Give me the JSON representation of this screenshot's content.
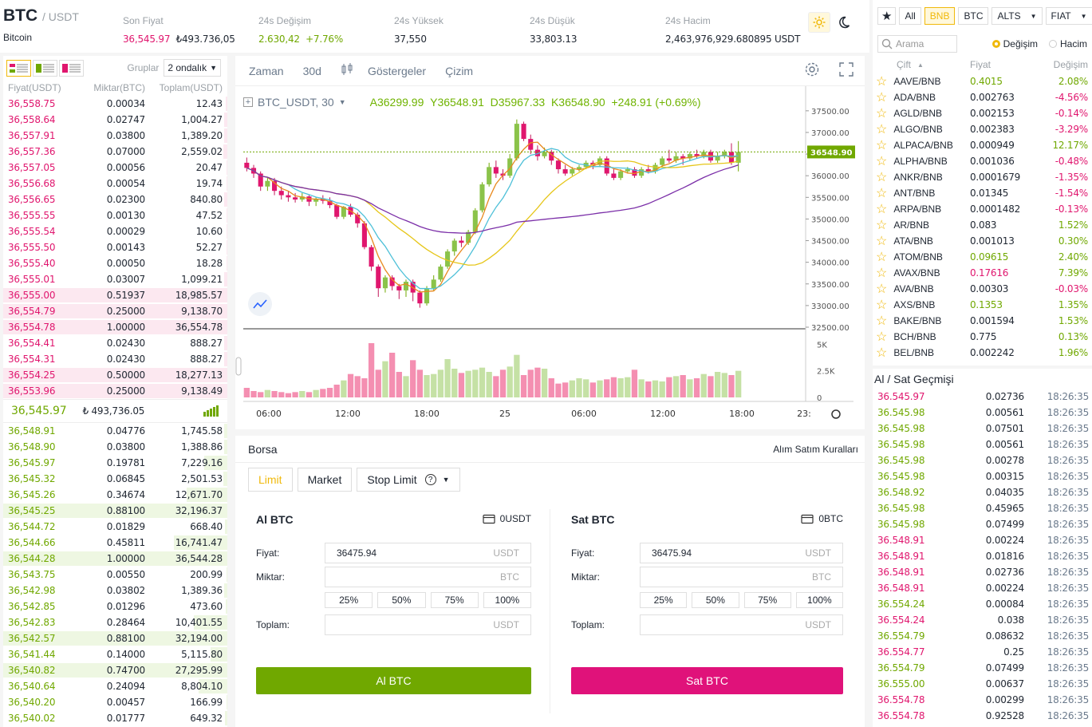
{
  "header": {
    "base": "BTC",
    "quote": "/ USDT",
    "name": "Bitcoin",
    "last_label": "Son Fiyat",
    "last_price": "36,545.97",
    "last_try": "₺493.736,05",
    "change_label": "24s Değişim",
    "change_abs": "2.630,42",
    "change_pct": "+7.76%",
    "high_label": "24s Yüksek",
    "high": "37,550",
    "low_label": "24s Düşük",
    "low": "33,803.13",
    "vol_label": "24s Hacim",
    "vol": "2,463,976,929.680895 USDT"
  },
  "orderbook": {
    "groups_label": "Gruplar",
    "decimals": "2 ondalık",
    "col_price": "Fiyat(USDT)",
    "col_amount": "Miktar(BTC)",
    "col_total": "Toplam(USDT)",
    "asks": [
      [
        "36,558.75",
        "0.00034",
        "12.43",
        2
      ],
      [
        "36,558.64",
        "0.02747",
        "1,004.27",
        4
      ],
      [
        "36,557.91",
        "0.03800",
        "1,389.20",
        4
      ],
      [
        "36,557.36",
        "0.07000",
        "2,559.02",
        6
      ],
      [
        "36,557.05",
        "0.00056",
        "20.47",
        1
      ],
      [
        "36,556.68",
        "0.00054",
        "19.74",
        1
      ],
      [
        "36,556.65",
        "0.02300",
        "840.80",
        4
      ],
      [
        "36,555.55",
        "0.00130",
        "47.52",
        1
      ],
      [
        "36,555.54",
        "0.00029",
        "10.60",
        1
      ],
      [
        "36,555.50",
        "0.00143",
        "52.27",
        1
      ],
      [
        "36,555.40",
        "0.00050",
        "18.28",
        1
      ],
      [
        "36,555.01",
        "0.03007",
        "1,099.21",
        5
      ],
      [
        "36,555.00",
        "0.51937",
        "18,985.57",
        100
      ],
      [
        "36,554.79",
        "0.25000",
        "9,138.70",
        100
      ],
      [
        "36,554.78",
        "1.00000",
        "36,554.78",
        100
      ],
      [
        "36,554.41",
        "0.02430",
        "888.27",
        4
      ],
      [
        "36,554.31",
        "0.02430",
        "888.27",
        4
      ],
      [
        "36,554.25",
        "0.50000",
        "18,277.13",
        100
      ],
      [
        "36,553.96",
        "0.25000",
        "9,138.49",
        100
      ]
    ],
    "mid_price": "36,545.97",
    "mid_try": "₺ 493,736.05",
    "bids": [
      [
        "36,548.91",
        "0.04776",
        "1,745.58",
        4
      ],
      [
        "36,548.90",
        "0.03800",
        "1,388.86",
        4
      ],
      [
        "36,545.97",
        "0.19781",
        "7,229.16",
        32
      ],
      [
        "36,545.32",
        "0.06845",
        "2,501.53",
        6
      ],
      [
        "36,545.26",
        "0.34674",
        "12,671.70",
        57
      ],
      [
        "36,545.25",
        "0.88100",
        "32,196.37",
        100
      ],
      [
        "36,544.72",
        "0.01829",
        "668.40",
        3
      ],
      [
        "36,544.66",
        "0.45811",
        "16,741.47",
        75
      ],
      [
        "36,544.28",
        "1.00000",
        "36,544.28",
        100
      ],
      [
        "36,543.75",
        "0.00550",
        "200.99",
        1
      ],
      [
        "36,542.98",
        "0.03802",
        "1,389.36",
        4
      ],
      [
        "36,542.85",
        "0.01296",
        "473.60",
        2
      ],
      [
        "36,542.83",
        "0.28464",
        "10,401.55",
        47
      ],
      [
        "36,542.57",
        "0.88100",
        "32,194.00",
        100
      ],
      [
        "36,541.44",
        "0.14000",
        "5,115.80",
        23
      ],
      [
        "36,540.82",
        "0.74700",
        "27,295.99",
        100
      ],
      [
        "36,540.64",
        "0.24094",
        "8,804.10",
        40
      ],
      [
        "36,540.20",
        "0.00457",
        "166.99",
        1
      ],
      [
        "36,540.02",
        "0.01777",
        "649.32",
        3
      ]
    ]
  },
  "chart": {
    "tools": [
      "Zaman",
      "30d",
      "Göstergeler",
      "Çizim"
    ],
    "title": "BTC_USDT, 30",
    "ohlc": {
      "a": "A36299.99",
      "y": "Y36548.91",
      "d": "D35967.33",
      "k": "K36548.90",
      "chg": "+248.91 (+0.69%)"
    },
    "price_axis": [
      "37500.00",
      "37000.00",
      "36500.00",
      "36000.00",
      "35500.00",
      "35000.00",
      "34500.00",
      "34000.00",
      "33500.00",
      "33000.00",
      "32500.00"
    ],
    "vol_axis": [
      "5K",
      "2.5K",
      "0"
    ],
    "time_axis": [
      "06:00",
      "12:00",
      "18:00",
      "25",
      "06:00",
      "12:00",
      "18:00",
      "23:"
    ],
    "last_tag": "36548.90"
  },
  "chart_data": {
    "type": "candlestick",
    "ylim": [
      32500,
      37700
    ],
    "candles": [
      [
        36300,
        36180,
        36420,
        36100
      ],
      [
        36180,
        36050,
        36250,
        35950
      ],
      [
        36050,
        35750,
        36100,
        35650
      ],
      [
        35750,
        35880,
        35950,
        35650
      ],
      [
        35880,
        35650,
        35950,
        35550
      ],
      [
        35650,
        35550,
        35750,
        35450
      ],
      [
        35550,
        35500,
        35650,
        35400
      ],
      [
        35500,
        35450,
        35600,
        35380
      ],
      [
        35450,
        35520,
        35600,
        35400
      ],
      [
        35520,
        35400,
        35550,
        35300
      ],
      [
        35400,
        35470,
        35500,
        35300
      ],
      [
        35470,
        35420,
        35550,
        35350
      ],
      [
        35420,
        35320,
        35500,
        35250
      ],
      [
        35320,
        35050,
        35350,
        35000
      ],
      [
        35050,
        35280,
        35300,
        35000
      ],
      [
        35280,
        35100,
        35350,
        35050
      ],
      [
        35100,
        34900,
        35150,
        34800
      ],
      [
        34900,
        34350,
        34950,
        34300
      ],
      [
        34350,
        33900,
        34400,
        33800
      ],
      [
        33900,
        33400,
        33950,
        33200
      ],
      [
        33400,
        33650,
        33700,
        33300
      ],
      [
        33650,
        33450,
        33700,
        33350
      ],
      [
        33450,
        33350,
        33500,
        33150
      ],
      [
        33350,
        33550,
        33600,
        33200
      ],
      [
        33550,
        33300,
        33600,
        33100
      ],
      [
        33300,
        33050,
        33350,
        32950
      ],
      [
        33050,
        33400,
        33450,
        33000
      ],
      [
        33400,
        33600,
        33700,
        33350
      ],
      [
        33600,
        33900,
        33950,
        33550
      ],
      [
        33900,
        34250,
        34300,
        33850
      ],
      [
        34250,
        34500,
        34550,
        34150
      ],
      [
        34500,
        34450,
        34600,
        34350
      ],
      [
        34450,
        34700,
        34750,
        34400
      ],
      [
        34700,
        35200,
        35250,
        34650
      ],
      [
        35200,
        35800,
        35850,
        35150
      ],
      [
        35800,
        36200,
        36300,
        35750
      ],
      [
        36200,
        36050,
        36350,
        35950
      ],
      [
        36050,
        36000,
        36150,
        35900
      ],
      [
        36000,
        36400,
        36500,
        35950
      ],
      [
        36400,
        37200,
        37300,
        36350
      ],
      [
        37200,
        36850,
        37250,
        36800
      ],
      [
        36850,
        36600,
        36950,
        36500
      ],
      [
        36600,
        36450,
        36700,
        36350
      ],
      [
        36450,
        36550,
        36650,
        36400
      ],
      [
        36550,
        36350,
        36600,
        36250
      ],
      [
        36350,
        36150,
        36400,
        36050
      ],
      [
        36150,
        36050,
        36250,
        36000
      ],
      [
        36050,
        36150,
        36200,
        36000
      ],
      [
        36150,
        36200,
        36250,
        36100
      ],
      [
        36200,
        36300,
        36350,
        36150
      ],
      [
        36300,
        36250,
        36350,
        36150
      ],
      [
        36250,
        36400,
        36450,
        36200
      ],
      [
        36400,
        36050,
        36450,
        36000
      ],
      [
        36050,
        35950,
        36150,
        35900
      ],
      [
        35950,
        36100,
        36150,
        35900
      ],
      [
        36100,
        36150,
        36200,
        36050
      ],
      [
        36150,
        36000,
        36200,
        35950
      ],
      [
        36000,
        36150,
        36200,
        35950
      ],
      [
        36150,
        36100,
        36250,
        36050
      ],
      [
        36100,
        36250,
        36300,
        36050
      ],
      [
        36250,
        36400,
        36450,
        36200
      ],
      [
        36400,
        36350,
        36600,
        36300
      ],
      [
        36350,
        36450,
        36550,
        36300
      ],
      [
        36450,
        36400,
        36500,
        36250
      ],
      [
        36400,
        36500,
        36550,
        36350
      ],
      [
        36500,
        36450,
        36600,
        36400
      ],
      [
        36450,
        36550,
        36600,
        36400
      ],
      [
        36550,
        36350,
        36600,
        36300
      ],
      [
        36350,
        36450,
        36550,
        36300
      ],
      [
        36450,
        36550,
        36600,
        36400
      ],
      [
        36550,
        36300,
        36750,
        36250
      ],
      [
        36300,
        36550,
        36800,
        36100
      ]
    ],
    "volume": [
      900,
      600,
      500,
      700,
      600,
      500,
      400,
      500,
      600,
      500,
      700,
      800,
      900,
      1200,
      1600,
      2200,
      2000,
      1800,
      5100,
      2600,
      3400,
      4200,
      2400,
      2000,
      3500,
      2600,
      2100,
      2200,
      2600,
      3600,
      2700,
      2300,
      2500,
      2600,
      2800,
      2400,
      2000,
      2600,
      2900,
      4000,
      2100,
      2600,
      2800,
      2700,
      1800,
      1300,
      1400,
      1600,
      1800,
      1700,
      1400,
      1600,
      1700,
      1900,
      1800,
      1900,
      2600,
      1700,
      1500,
      1600,
      1500,
      1900,
      2000,
      2100,
      1700,
      1800,
      2200,
      2000,
      2400,
      2300,
      2100,
      2500
    ]
  },
  "trade": {
    "title": "Borsa",
    "rules": "Alım Satım Kuralları",
    "tabs": [
      "Limit",
      "Market",
      "Stop Limit"
    ],
    "buy": {
      "title": "Al BTC",
      "balance": "0USDT",
      "price_label": "Fiyat:",
      "price": "36475.94",
      "price_unit": "USDT",
      "amount_label": "Miktar:",
      "amount_unit": "BTC",
      "total_label": "Toplam:",
      "total_unit": "USDT",
      "button": "Al BTC"
    },
    "sell": {
      "title": "Sat BTC",
      "balance": "0BTC",
      "price_label": "Fiyat:",
      "price": "36475.94",
      "price_unit": "USDT",
      "amount_label": "Miktar:",
      "amount_unit": "BTC",
      "total_label": "Toplam:",
      "total_unit": "USDT",
      "button": "Sat BTC"
    },
    "pcts": [
      "25%",
      "50%",
      "75%",
      "100%"
    ]
  },
  "market": {
    "tabs": [
      "All",
      "BNB",
      "BTC",
      "ALTS",
      "FIAT"
    ],
    "search": "Arama",
    "opt1": "Değişim",
    "opt2": "Hacim",
    "col_pair": "Çift",
    "col_price": "Fiyat",
    "col_change": "Değişim",
    "rows": [
      [
        "AAVE/BNB",
        "0.4015",
        "2.08%",
        "u",
        "u"
      ],
      [
        "ADA/BNB",
        "0.002763",
        "-4.56%",
        "n",
        "d"
      ],
      [
        "AGLD/BNB",
        "0.002153",
        "-0.14%",
        "n",
        "d"
      ],
      [
        "ALGO/BNB",
        "0.002383",
        "-3.29%",
        "n",
        "d"
      ],
      [
        "ALPACA/BNB",
        "0.000949",
        "12.17%",
        "n",
        "u"
      ],
      [
        "ALPHA/BNB",
        "0.001036",
        "-0.48%",
        "n",
        "d"
      ],
      [
        "ANKR/BNB",
        "0.0001679",
        "-1.35%",
        "n",
        "d"
      ],
      [
        "ANT/BNB",
        "0.01345",
        "-1.54%",
        "n",
        "d"
      ],
      [
        "ARPA/BNB",
        "0.0001482",
        "-0.13%",
        "n",
        "d"
      ],
      [
        "AR/BNB",
        "0.083",
        "1.52%",
        "n",
        "u"
      ],
      [
        "ATA/BNB",
        "0.001013",
        "0.30%",
        "n",
        "u"
      ],
      [
        "ATOM/BNB",
        "0.09615",
        "2.40%",
        "u",
        "u"
      ],
      [
        "AVAX/BNB",
        "0.17616",
        "7.39%",
        "d",
        "u"
      ],
      [
        "AVA/BNB",
        "0.00303",
        "-0.03%",
        "n",
        "d"
      ],
      [
        "AXS/BNB",
        "0.1353",
        "1.35%",
        "u",
        "u"
      ],
      [
        "BAKE/BNB",
        "0.001594",
        "1.53%",
        "n",
        "u"
      ],
      [
        "BCH/BNB",
        "0.775",
        "0.13%",
        "n",
        "u"
      ],
      [
        "BEL/BNB",
        "0.002242",
        "1.96%",
        "n",
        "u"
      ]
    ]
  },
  "history": {
    "title": "Al / Sat Geçmişi",
    "rows": [
      [
        "36.545.97",
        "0.02736",
        "18:26:35",
        "d"
      ],
      [
        "36.545.98",
        "0.00561",
        "18:26:35",
        "u"
      ],
      [
        "36.545.98",
        "0.07501",
        "18:26:35",
        "u"
      ],
      [
        "36.545.98",
        "0.00561",
        "18:26:35",
        "u"
      ],
      [
        "36.545.98",
        "0.00278",
        "18:26:35",
        "u"
      ],
      [
        "36.545.98",
        "0.00315",
        "18:26:35",
        "u"
      ],
      [
        "36.548.92",
        "0.04035",
        "18:26:35",
        "u"
      ],
      [
        "36.545.98",
        "0.45965",
        "18:26:35",
        "u"
      ],
      [
        "36.545.98",
        "0.07499",
        "18:26:35",
        "u"
      ],
      [
        "36.548.91",
        "0.00224",
        "18:26:35",
        "d"
      ],
      [
        "36.548.91",
        "0.01816",
        "18:26:35",
        "d"
      ],
      [
        "36.548.91",
        "0.02736",
        "18:26:35",
        "d"
      ],
      [
        "36.548.91",
        "0.00224",
        "18:26:35",
        "d"
      ],
      [
        "36.554.24",
        "0.00084",
        "18:26:35",
        "u"
      ],
      [
        "36.554.24",
        "0.038",
        "18:26:35",
        "d"
      ],
      [
        "36.554.79",
        "0.08632",
        "18:26:35",
        "u"
      ],
      [
        "36.554.77",
        "0.25",
        "18:26:35",
        "d"
      ],
      [
        "36.554.79",
        "0.07499",
        "18:26:35",
        "u"
      ],
      [
        "36.555.00",
        "0.00637",
        "18:26:35",
        "u"
      ],
      [
        "36.554.78",
        "0.00299",
        "18:26:35",
        "d"
      ],
      [
        "36.554.78",
        "0.92528",
        "18:26:35",
        "d"
      ]
    ]
  }
}
